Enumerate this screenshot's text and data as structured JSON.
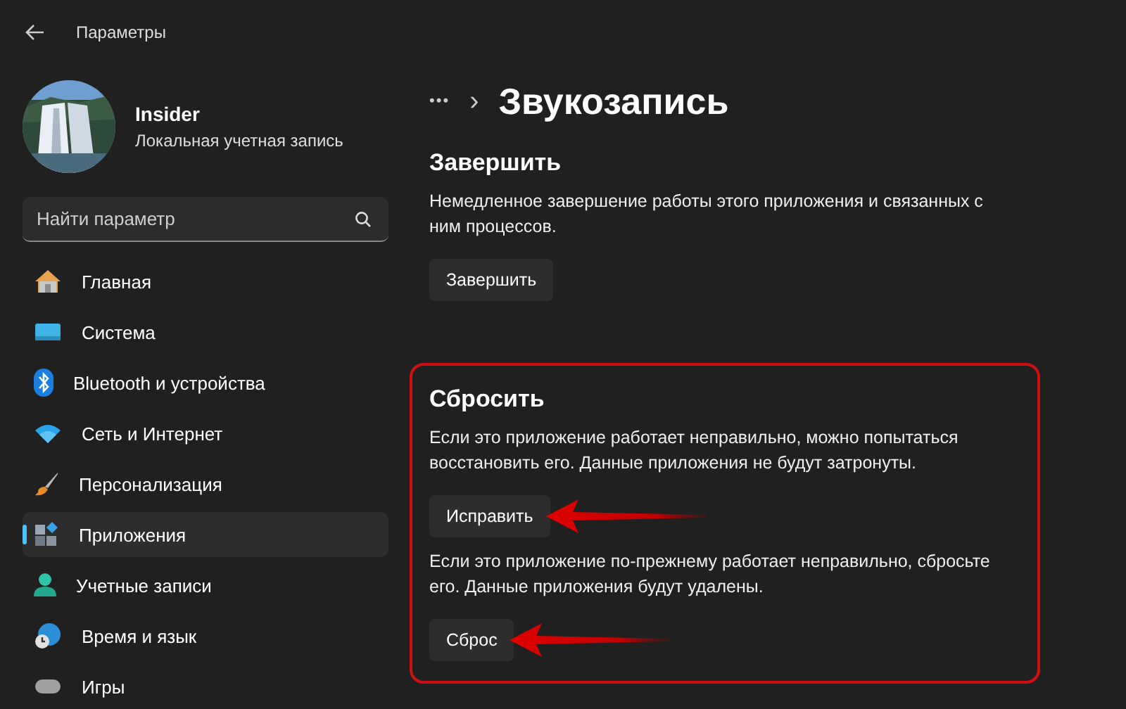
{
  "window": {
    "title": "Параметры"
  },
  "account": {
    "name": "Insider",
    "type": "Локальная учетная запись"
  },
  "search": {
    "placeholder": "Найти параметр"
  },
  "sidebar": {
    "items": [
      {
        "label": "Главная",
        "kind": "home",
        "selected": false
      },
      {
        "label": "Система",
        "kind": "system",
        "selected": false
      },
      {
        "label": "Bluetooth и устройства",
        "kind": "bluetooth",
        "selected": false
      },
      {
        "label": "Сеть и Интернет",
        "kind": "network",
        "selected": false
      },
      {
        "label": "Персонализация",
        "kind": "brush",
        "selected": false
      },
      {
        "label": "Приложения",
        "kind": "apps",
        "selected": true
      },
      {
        "label": "Учетные записи",
        "kind": "accounts",
        "selected": false
      },
      {
        "label": "Время и язык",
        "kind": "time",
        "selected": false
      },
      {
        "label": "Игры",
        "kind": "games",
        "selected": false
      }
    ]
  },
  "breadcrumb": {
    "more": "•••",
    "separator": "›",
    "title": "Звукозапись"
  },
  "sections": [
    {
      "title": "Завершить",
      "highlighted": false,
      "blocks": [
        {
          "description": "Немедленное завершение работы этого приложения и связанных с ним процессов.",
          "button": "Завершить",
          "annotated": false
        }
      ]
    },
    {
      "title": "Сбросить",
      "highlighted": true,
      "blocks": [
        {
          "description": "Если это приложение работает неправильно, можно попытаться восстановить его. Данные приложения не будут затронуты.",
          "button": "Исправить",
          "annotated": true
        },
        {
          "description": "Если это приложение по-прежнему работает неправильно, сбросьте его. Данные приложения будут удалены.",
          "button": "Сброс",
          "annotated": true
        }
      ]
    }
  ]
}
